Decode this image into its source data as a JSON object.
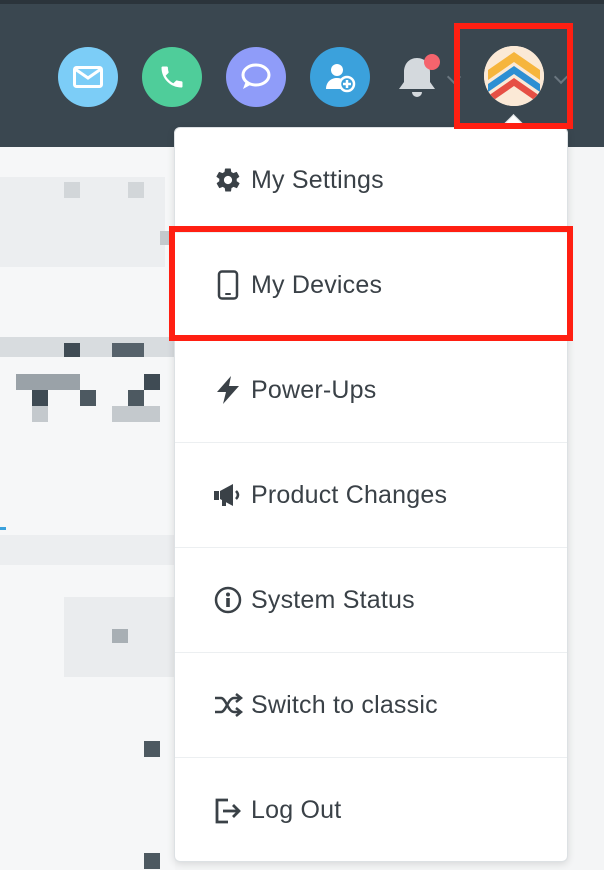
{
  "header": {
    "icons": [
      {
        "name": "email-icon",
        "color": "#7ccdf7"
      },
      {
        "name": "phone-icon",
        "color": "#4fcd9a"
      },
      {
        "name": "chat-icon",
        "color": "#8f9cf9"
      },
      {
        "name": "add-contact-icon",
        "color": "#3ba1dc"
      }
    ],
    "notification_badge_color": "#f4646d"
  },
  "menu": {
    "items": [
      {
        "label": "My Settings",
        "icon": "gear-icon"
      },
      {
        "label": "My Devices",
        "icon": "mobile-phone-icon"
      },
      {
        "label": "Power-Ups",
        "icon": "lightning-icon"
      },
      {
        "label": "Product Changes",
        "icon": "megaphone-icon"
      },
      {
        "label": "System Status",
        "icon": "info-circle-icon"
      },
      {
        "label": "Switch to classic",
        "icon": "shuffle-icon"
      },
      {
        "label": "Log Out",
        "icon": "logout-icon"
      }
    ]
  },
  "highlight_color": "#ff1f12"
}
